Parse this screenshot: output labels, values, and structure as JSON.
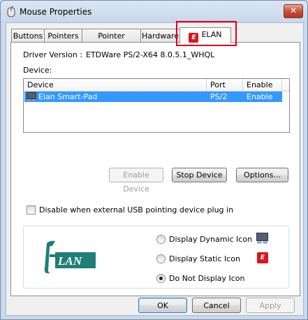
{
  "window": {
    "title": "Mouse Properties",
    "close_label": "✕"
  },
  "tabs": [
    {
      "label": "Buttons"
    },
    {
      "label": "Pointers"
    },
    {
      "label": "Pointer Options"
    },
    {
      "label": "Hardware"
    },
    {
      "label": "ELAN",
      "icon": "elan-icon",
      "active": true
    }
  ],
  "elan_tab": {
    "driver_version_label": "Driver Version :",
    "driver_version_value": "ETDWare PS/2-X64 8.0.5.1_WHQL",
    "device_label": "Device:",
    "device_list": {
      "columns": [
        "Device",
        "Port",
        "Enable"
      ],
      "rows": [
        {
          "device": "Elan Smart-Pad",
          "port": "PS/2",
          "enable": "Enable",
          "icon": "touchpad-icon",
          "selected": true
        }
      ]
    },
    "buttons": {
      "enable_device": "Enable Device",
      "stop_device": "Stop Device",
      "options": "Options..."
    },
    "disable_usb_checkbox": {
      "label": "Disable when external USB pointing device plug in",
      "checked": false
    },
    "tray_icon_options": [
      {
        "label": "Display Dynamic Icon",
        "selected": false,
        "icon": "touchpad-icon"
      },
      {
        "label": "Display Static Icon",
        "selected": false,
        "icon": "elan-icon"
      },
      {
        "label": "Do Not Display Icon",
        "selected": true
      }
    ],
    "logo_text": "ELAN"
  },
  "footer": {
    "ok": "OK",
    "cancel": "Cancel",
    "apply": "Apply"
  },
  "colors": {
    "selection": "#3399ff",
    "elan_red": "#d8171d",
    "logo_teal": "#1f7f78",
    "highlight_red": "#e0001a"
  }
}
